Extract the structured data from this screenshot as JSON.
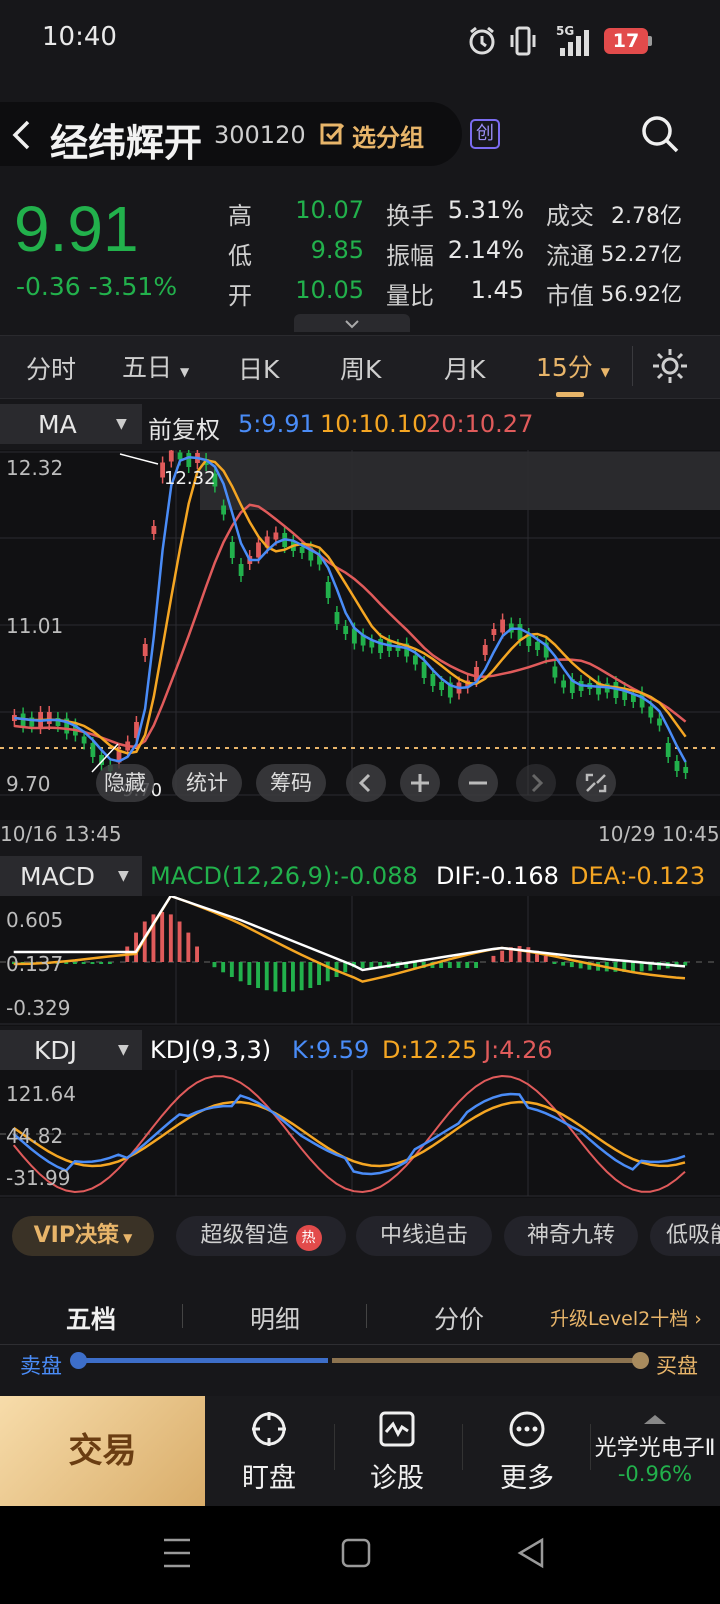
{
  "status": {
    "time": "10:40",
    "battery": "17",
    "network": "5G"
  },
  "header": {
    "name": "经纬辉开",
    "code": "300120",
    "watch_label": "选分组",
    "board_badge": "创"
  },
  "quote": {
    "price": "9.91",
    "change": "-0.36 -3.51%",
    "rows": [
      [
        {
          "label": "高",
          "value": "10.07"
        },
        {
          "label": "换手",
          "value": "5.31%"
        },
        {
          "label": "成交",
          "value": "2.78亿"
        }
      ],
      [
        {
          "label": "低",
          "value": "9.85"
        },
        {
          "label": "振幅",
          "value": "2.14%"
        },
        {
          "label": "流通",
          "value": "52.27亿"
        }
      ],
      [
        {
          "label": "开",
          "value": "10.05"
        },
        {
          "label": "量比",
          "value": "1.45"
        },
        {
          "label": "市值",
          "value": "56.92亿"
        }
      ]
    ]
  },
  "period_tabs": [
    "分时",
    "五日",
    "日K",
    "周K",
    "月K",
    "15分"
  ],
  "active_tab": "15分",
  "main_chart": {
    "indicator": "MA",
    "adjust": "前复权",
    "ma5": "5:9.91",
    "ma10": "10:10.10",
    "ma20": "20:10.27",
    "y_max": "12.32",
    "y_mid": "11.01",
    "y_min": "9.70",
    "high_marker": "12.32",
    "low_marker": "9.70",
    "x_start": "10/16 13:45",
    "x_end": "10/29 10:45",
    "tools": [
      "隐藏",
      "统计",
      "筹码"
    ]
  },
  "macd": {
    "indicator": "MACD",
    "macd": "MACD(12,26,9):-0.088",
    "dif": "DIF:-0.168",
    "dea": "DEA:-0.123",
    "y_top": "0.605",
    "y_mid": "0.137",
    "y_bot": "-0.329"
  },
  "kdj": {
    "indicator": "KDJ",
    "params": "KDJ(9,3,3)",
    "k": "K:9.59",
    "d": "D:12.25",
    "j": "J:4.26",
    "y_top": "121.64",
    "y_mid": "44.82",
    "y_bot": "-31.99"
  },
  "signals": {
    "vip_label": "VIP决策",
    "items": [
      "超级智造",
      "中线追击",
      "神奇九转",
      "低吸能"
    ],
    "hot_badge": "热"
  },
  "order_book": {
    "tabs": [
      "五档",
      "明细",
      "分价"
    ],
    "upgrade": "升级Level2十档",
    "sell_label": "卖盘",
    "buy_label": "买盘"
  },
  "bottom_nav": {
    "trade": "交易",
    "items": [
      "盯盘",
      "诊股",
      "更多"
    ],
    "sector_name": "光学光电子Ⅱ",
    "sector_change": "-0.96%"
  },
  "colors": {
    "up": "#e05b5b",
    "down": "#22b14c",
    "ma5": "#4a8cf7",
    "ma10": "#f5a623",
    "ma20": "#e05b5b",
    "accent": "#e8b56a"
  }
}
